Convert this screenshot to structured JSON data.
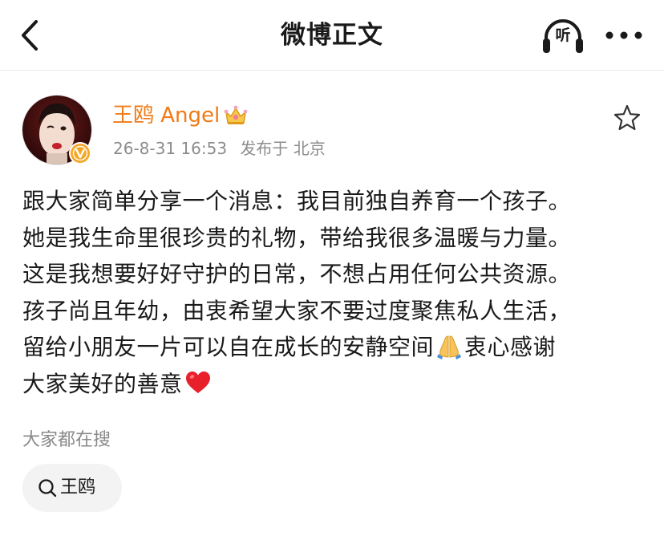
{
  "navbar": {
    "title": "微博正文",
    "listen_label": "听",
    "back_icon": "chevron-left-icon",
    "more_icon": "more-dots-icon",
    "listen_icon": "headphones-icon"
  },
  "post": {
    "author": {
      "name": "王鸥 Angel",
      "name_color": "#f07a14",
      "badge_icon": "crown-icon",
      "verified_icon": "verified-v-icon",
      "verified_color": "#f5a623"
    },
    "timestamp": "26-8-31 16:53",
    "location": "发布于 北京",
    "favorite_icon": "star-outline-icon",
    "body_lines": [
      {
        "text": "跟大家简单分享一个消息：我目前独自养育一个孩子。"
      },
      {
        "text": "她是我生命里很珍贵的礼物，带给我很多温暖与力量。"
      },
      {
        "text": "这是我想要好好守护的日常，不想占用任何公共资源。"
      },
      {
        "text": "孩子尚且年幼，由衷希望大家不要过度聚焦私人生活，"
      },
      {
        "text": "留给小朋友一片可以自在成长的安静空间",
        "emoji": "folded-hands-emoji",
        "text_after": "衷心感谢"
      },
      {
        "text": "大家美好的善意",
        "emoji": "red-heart-emoji"
      }
    ]
  },
  "hot_search": {
    "label": "大家都在搜",
    "chips": [
      {
        "label": "王鸥",
        "icon": "search-icon"
      }
    ]
  }
}
